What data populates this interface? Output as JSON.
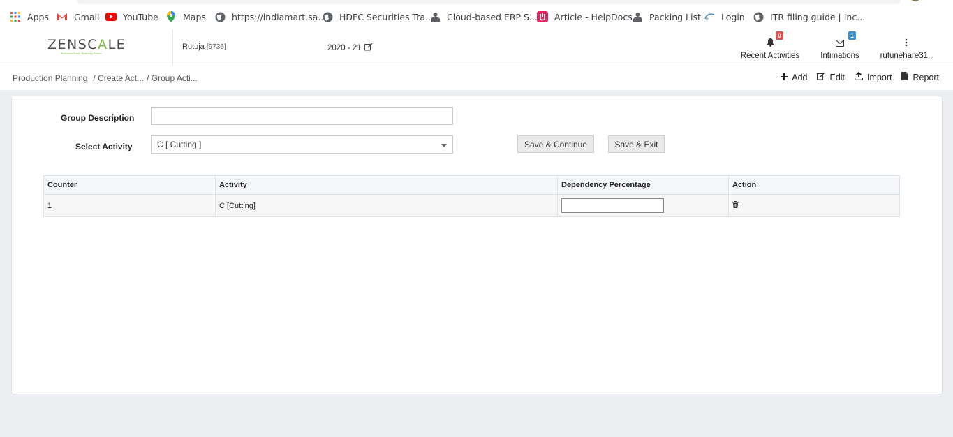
{
  "bookmarks": [
    {
      "label": "Apps",
      "icon": "apps-grid-icon"
    },
    {
      "label": "Gmail",
      "icon": "gmail-icon"
    },
    {
      "label": "YouTube",
      "icon": "youtube-icon"
    },
    {
      "label": "Maps",
      "icon": "maps-pin-icon"
    },
    {
      "label": "https://indiamart.sa...",
      "icon": "globe-icon"
    },
    {
      "label": "HDFC Securities Tra...",
      "icon": "globe-icon"
    },
    {
      "label": "Cloud-based ERP S...",
      "icon": "erp-icon"
    },
    {
      "label": "Article - HelpDocs",
      "icon": "helpdocs-icon"
    },
    {
      "label": "Packing List",
      "icon": "erp-icon"
    },
    {
      "label": "Login",
      "icon": "login-icon"
    },
    {
      "label": "ITR filing guide | Inc...",
      "icon": "globe-icon"
    }
  ],
  "header": {
    "logo_left": "ZENSC",
    "logo_mid": "A",
    "logo_right": "LE",
    "logo_tagline": "Business Ease. Business Peace.",
    "user": "Rutuja",
    "user_code": "[9736]",
    "financial_year": "2020 - 21",
    "recent_activities_label": "Recent Activities",
    "recent_activities_count": "0",
    "intimations_label": "Intimations",
    "intimations_count": "1",
    "account_label": "rutunehare31.."
  },
  "breadcrumb": {
    "root": "Production Planning",
    "step2": "/ Create Act...",
    "step3": "/ Group Acti..."
  },
  "toolbar": {
    "add": "Add",
    "edit": "Edit",
    "import": "Import",
    "report": "Report"
  },
  "form": {
    "group_description_label": "Group Description",
    "group_description_value": "",
    "select_activity_label": "Select Activity",
    "select_activity_value": "C [ Cutting ]",
    "save_continue": "Save & Continue",
    "save_exit": "Save & Exit"
  },
  "table": {
    "headers": [
      "Counter",
      "Activity",
      "Dependency Percentage",
      "Action"
    ],
    "rows": [
      {
        "counter": "1",
        "activity": "C [Cutting]",
        "dependency": ""
      }
    ]
  },
  "colors": {
    "badge_red": "#d9534f",
    "badge_blue": "#3a8fd1",
    "logo_green": "#7bbf3a"
  }
}
